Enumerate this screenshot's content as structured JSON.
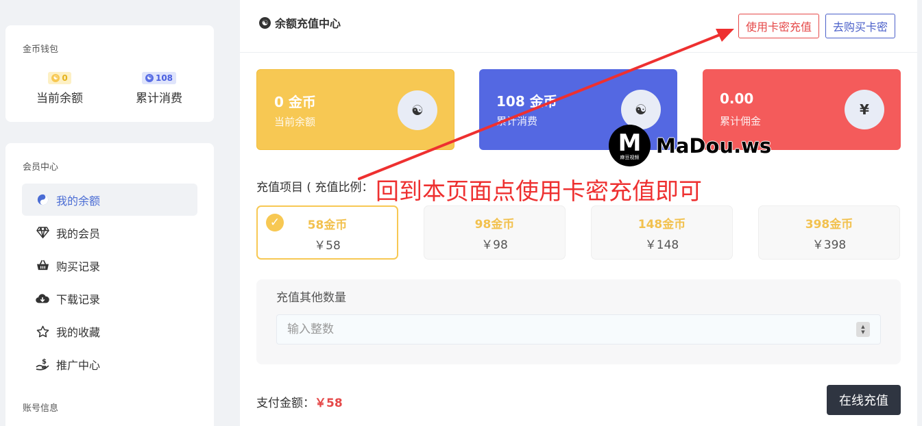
{
  "sidebar": {
    "wallet": {
      "title": "金币钱包",
      "balance": {
        "badge": "0",
        "label": "当前余额"
      },
      "spent": {
        "badge": "108",
        "label": "累计消费"
      }
    },
    "member": {
      "title": "会员中心",
      "items": [
        {
          "label": "我的余额",
          "icon": "yin-yang-icon",
          "active": true
        },
        {
          "label": "我的会员",
          "icon": "diamond-icon"
        },
        {
          "label": "购买记录",
          "icon": "basket-icon"
        },
        {
          "label": "下载记录",
          "icon": "cloud-download-icon"
        },
        {
          "label": "我的收藏",
          "icon": "star-icon"
        },
        {
          "label": "推广中心",
          "icon": "hand-coin-icon"
        }
      ],
      "account_title": "账号信息"
    }
  },
  "main": {
    "title": "余额充值中心",
    "use_card_label": "使用卡密充值",
    "buy_card_label": "去购买卡密",
    "stats": [
      {
        "value": "0 金币",
        "label": "当前余额",
        "icon": "yin-yang-icon",
        "color": "#f7c853"
      },
      {
        "value": "108 金币",
        "label": "累计消费",
        "icon": "yin-yang-icon",
        "color": "#5468e2"
      },
      {
        "value": "0.00",
        "label": "累计佣金",
        "icon": "yen-icon",
        "icon_text": "¥",
        "color": "#f45b5b"
      }
    ],
    "recharge_label": "充值项目 ( 充值比例：",
    "packages": [
      {
        "coins": "58金币",
        "price": "￥58",
        "selected": true
      },
      {
        "coins": "98金币",
        "price": "￥98"
      },
      {
        "coins": "148金币",
        "price": "￥148"
      },
      {
        "coins": "398金币",
        "price": "￥398"
      }
    ],
    "other_label": "充值其他数量",
    "other_placeholder": "输入整数",
    "pay_label": "支付金额：",
    "pay_amount": "￥58",
    "pay_button": "在线充值"
  },
  "overlay": {
    "annotation": "回到本页面点使用卡密充值即可",
    "watermark_text": "MaDou.ws",
    "watermark_logo_letter": "M",
    "watermark_logo_sub": "麻豆视频"
  },
  "colors": {
    "accent_yellow": "#f7c853",
    "accent_blue": "#5468e2",
    "accent_red": "#f45b5b",
    "annotation_red": "#ee3030",
    "dark_button": "#2f3541"
  }
}
